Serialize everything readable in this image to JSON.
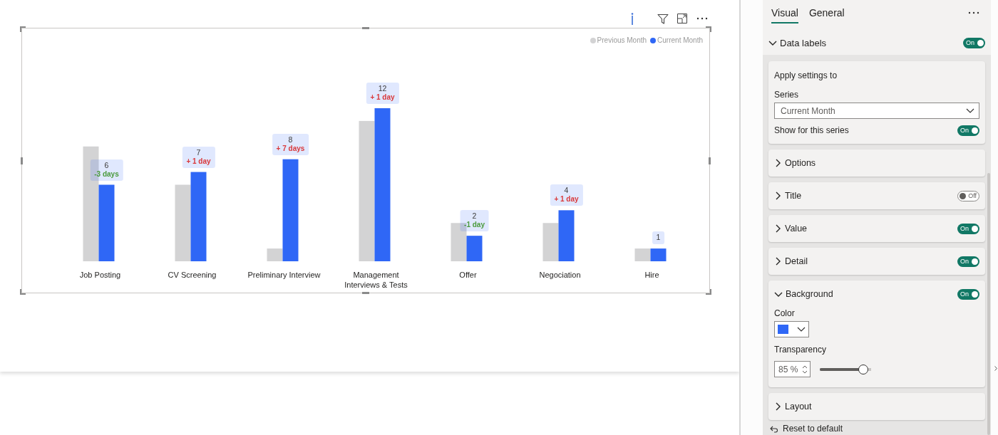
{
  "visual": {
    "chart_data": {
      "type": "bar",
      "categories": [
        "Job Posting",
        "CV Screening",
        "Preliminary Interview",
        "Management Interviews & Tests",
        "Offer",
        "Negociation",
        "Hire"
      ],
      "series": [
        {
          "name": "Previous Month",
          "color": "#d3d3d4",
          "values": [
            9,
            6,
            1,
            11,
            3,
            3,
            1
          ],
          "value_labels": [
            null,
            null,
            null,
            null,
            null,
            null,
            null
          ]
        },
        {
          "name": "Current Month",
          "color": "#2f67f6",
          "values": [
            6,
            7,
            8,
            12,
            2,
            4,
            1
          ],
          "value_labels": [
            "6",
            "7",
            "8",
            "12",
            "2",
            "4",
            "1"
          ]
        }
      ]
    },
    "label_details": [
      {
        "text": "-3 days",
        "color": "#4a9a3c"
      },
      {
        "text": "+ 1 day",
        "color": "#d9383a"
      },
      {
        "text": "+ 7 days",
        "color": "#d9383a"
      },
      {
        "text": "+ 1 day",
        "color": "#d9383a"
      },
      {
        "text": "-1 day",
        "color": "#4a9a3c"
      },
      {
        "text": "+ 1 day",
        "color": "#d9383a"
      }
    ]
  },
  "format_pane": {
    "tabs": [
      {
        "label": "Visual",
        "selected": true
      },
      {
        "label": "General",
        "selected": false
      }
    ],
    "group": {
      "title": "Data labels",
      "expanded": true,
      "toggle": {
        "on": true,
        "label": "On"
      }
    },
    "apply_settings": {
      "heading": "Apply settings to",
      "series_label": "Series",
      "series_value": "Current Month",
      "show_label": "Show for this series",
      "toggle": {
        "on": true,
        "label": "On"
      }
    },
    "sections": [
      {
        "kind": "plain",
        "title": "Options",
        "expanded": false
      },
      {
        "kind": "plain",
        "title": "Title",
        "expanded": false,
        "toggle": {
          "on": false,
          "label": "Off"
        }
      },
      {
        "kind": "plain",
        "title": "Value",
        "expanded": false,
        "toggle": {
          "on": true,
          "label": "On"
        }
      },
      {
        "kind": "plain",
        "title": "Detail",
        "expanded": false,
        "toggle": {
          "on": true,
          "label": "On"
        }
      },
      {
        "kind": "background",
        "title": "Background",
        "expanded": true,
        "toggle": {
          "on": true,
          "label": "On"
        },
        "color_label": "Color",
        "color": "#2f67f6",
        "transparency_label": "Transparency",
        "transparency_value": "85 %",
        "level": 0.85
      },
      {
        "kind": "plain",
        "title": "Layout",
        "expanded": false
      }
    ],
    "reset": "Reset to default"
  }
}
